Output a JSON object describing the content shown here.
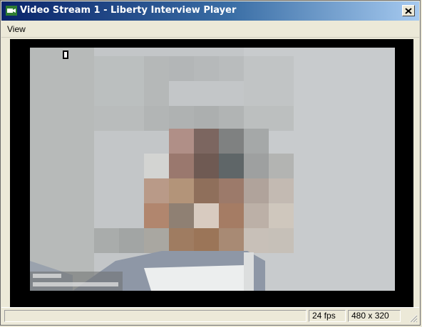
{
  "window": {
    "title": "Video Stream 1 - Liberty Interview Player",
    "close_icon": "close-icon",
    "app_icon": "camera-icon"
  },
  "menu": {
    "items": [
      {
        "label": "View"
      }
    ]
  },
  "video": {
    "overlay_icon": "recording-indicator-icon",
    "content": "pixelated-video-frame"
  },
  "status": {
    "message": "",
    "fps": "24 fps",
    "resolution": "480 x 320"
  },
  "colors": {
    "titlebar_start": "#0a246a",
    "titlebar_end": "#a6caf0",
    "chrome": "#ece9d8",
    "video_bg": "#000000"
  }
}
